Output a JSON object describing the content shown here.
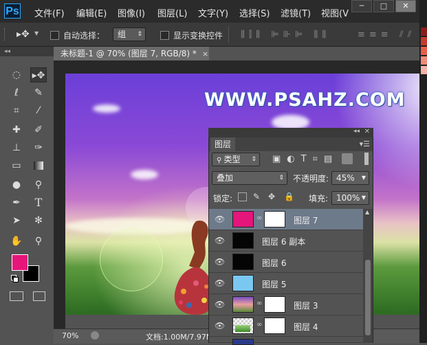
{
  "app": {
    "logo": "Ps"
  },
  "menu": [
    "文件(F)",
    "编辑(E)",
    "图像(I)",
    "图层(L)",
    "文字(Y)",
    "选择(S)",
    "滤镜(T)",
    "视图(V"
  ],
  "window_controls": {
    "minimize": "─",
    "restore": "□",
    "close": "✕"
  },
  "options_bar": {
    "auto_select_label": "自动选择：",
    "auto_select_value": "组",
    "show_transform_label": "显示变换控件"
  },
  "document": {
    "tab_title": "未标题-1 @ 70% (图层 7, RGB/8) *",
    "close_glyph": "×",
    "watermark": "WWW.PSAHZ.COM"
  },
  "colors": {
    "foreground": "#e6157a",
    "background": "#000000",
    "selected_layer_thumb": "#e4157b",
    "layer5_thumb": "#7ac8f2"
  },
  "status_bar": {
    "zoom": "70%",
    "doc_info": "文档:1.00M/7.97M"
  },
  "layers_panel": {
    "tab_label": "图层",
    "filter_label": "类型",
    "blend_mode": "叠加",
    "opacity_label": "不透明度:",
    "opacity_value": "45%",
    "lock_label": "锁定:",
    "fill_label": "填充:",
    "fill_value": "100%",
    "layers": [
      {
        "name": "图层 7",
        "selected": true,
        "has_mask": true
      },
      {
        "name": "图层 6 副本",
        "selected": false,
        "has_mask": false
      },
      {
        "name": "图层 6",
        "selected": false,
        "has_mask": false
      },
      {
        "name": "图层 5",
        "selected": false,
        "has_mask": false
      },
      {
        "name": "图层 3",
        "selected": false,
        "has_mask": true
      },
      {
        "name": "图层 4",
        "selected": false,
        "has_mask": true
      }
    ]
  },
  "tools": [
    "rectangular-marquee-tool",
    "move-tool",
    "lasso-tool",
    "quick-selection-tool",
    "crop-tool",
    "eyedropper-tool",
    "healing-brush-tool",
    "brush-tool",
    "clone-stamp-tool",
    "history-brush-tool",
    "eraser-tool",
    "gradient-tool",
    "blur-tool",
    "dodge-tool",
    "pen-tool",
    "type-tool",
    "path-selection-tool",
    "custom-shape-tool",
    "hand-tool",
    "zoom-tool"
  ]
}
